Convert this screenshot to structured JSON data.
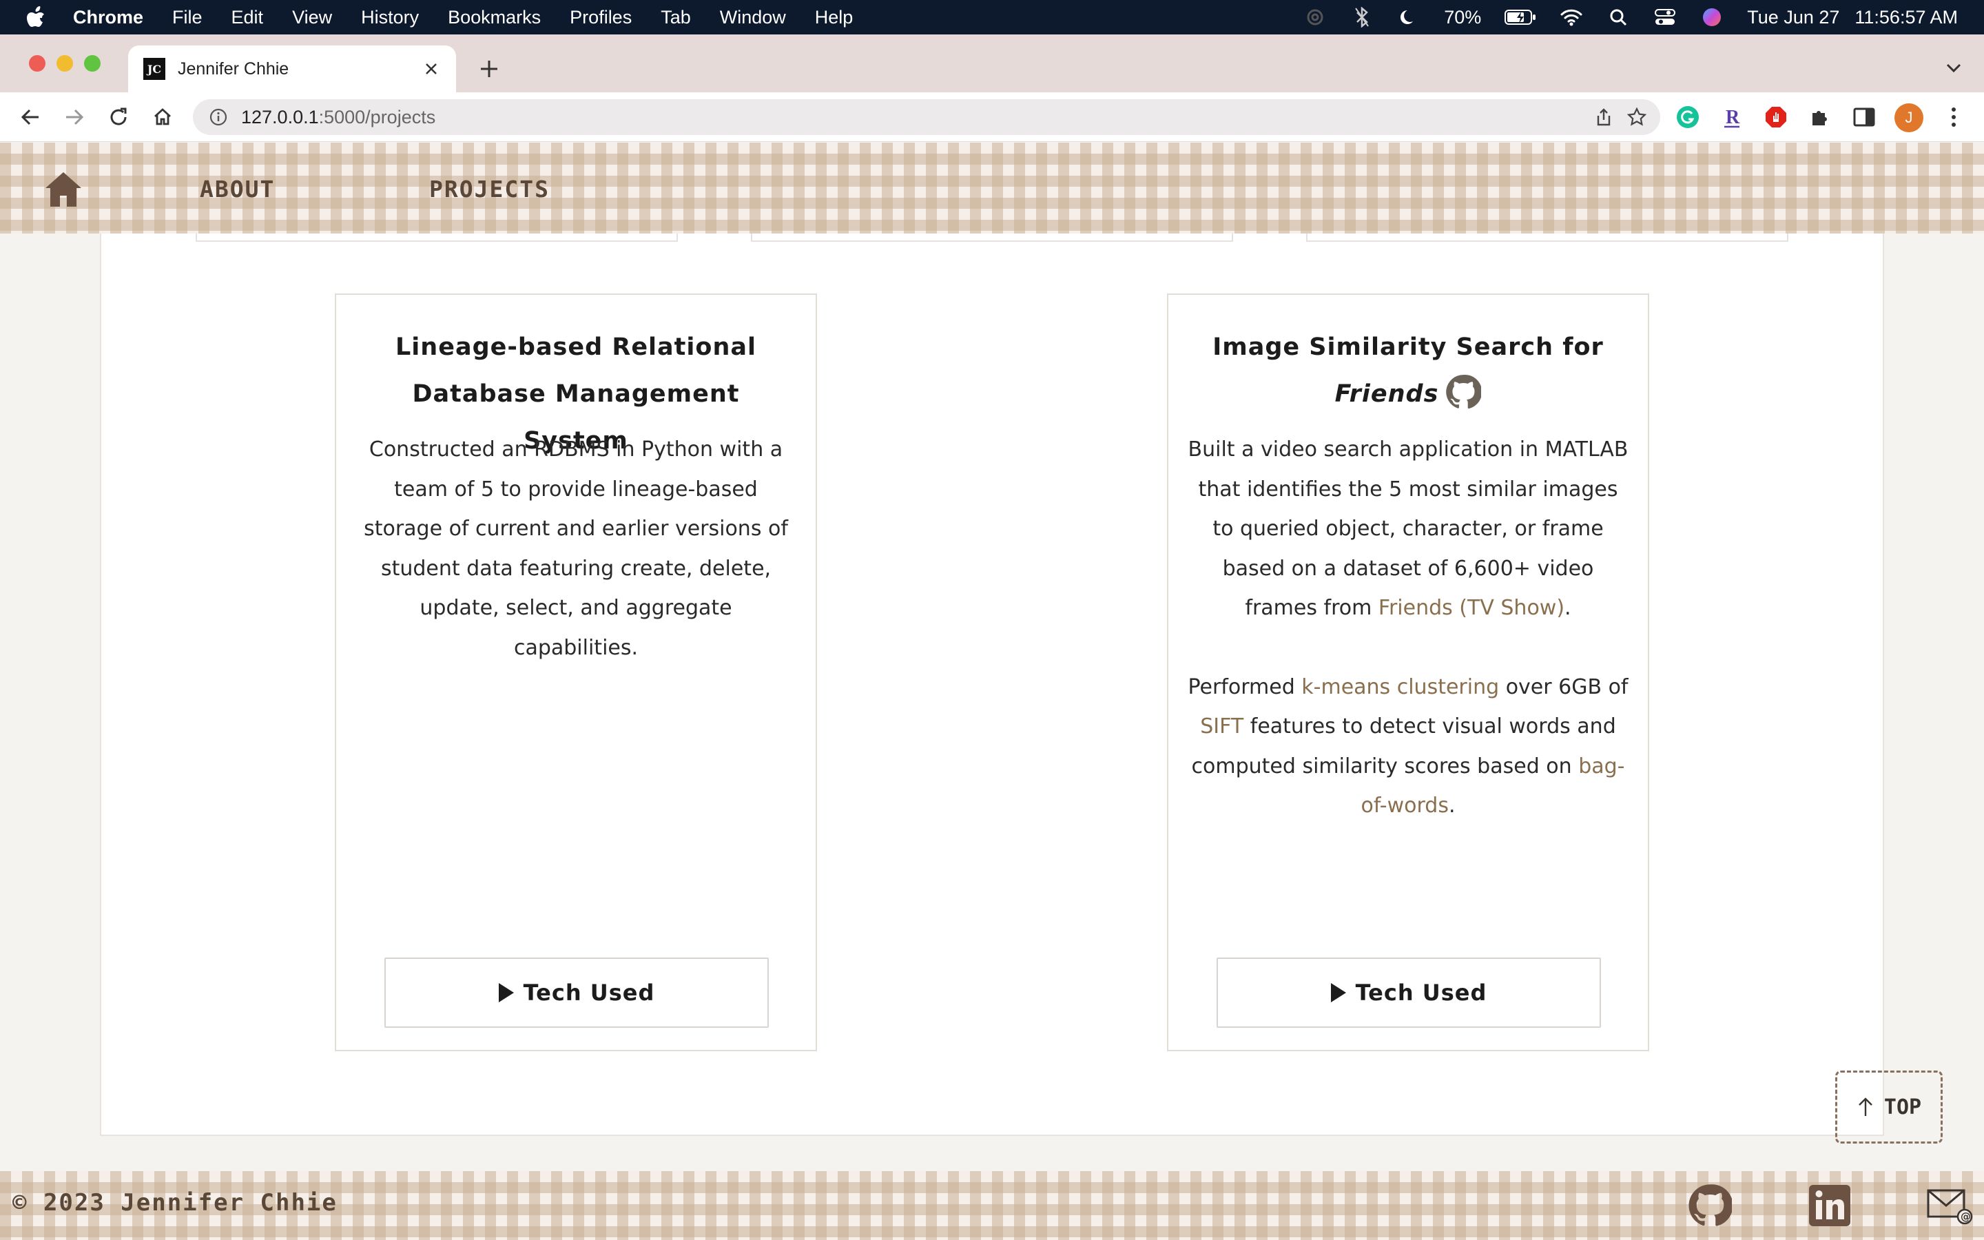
{
  "menubar": {
    "app": "Chrome",
    "items": [
      "File",
      "Edit",
      "View",
      "History",
      "Bookmarks",
      "Profiles",
      "Tab",
      "Window",
      "Help"
    ],
    "battery": "70%",
    "date": "Tue Jun 27",
    "time": "11:56:57 AM"
  },
  "browser": {
    "tab_title": "Jennifer Chhie",
    "favicon_text": "JC",
    "url_host": "127.0.0.1",
    "url_path": ":5000/projects",
    "profile_initial": "J"
  },
  "nav": {
    "about": "ABOUT",
    "projects": "PROJECTS"
  },
  "cards": [
    {
      "title_line1": "Lineage-based Relational",
      "title_line2": "Database Management System",
      "description": "Constructed an RDBMS in Python with a team of 5 to provide lineage-based storage of current and earlier versions of student data featuring create, delete, update, select, and aggregate capabilities.",
      "button": "Tech Used"
    },
    {
      "title_line1": "Image Similarity Search for",
      "title_line2": "Friends",
      "desc_p1_a": "Built a video search application in MATLAB that identifies the 5 most similar images to queried object, character, or frame based on a dataset of 6,600+ video frames from ",
      "desc_p1_link": "Friends (TV Show)",
      "desc_p1_b": ".",
      "desc_p2_a": "Performed ",
      "desc_p2_link1": "k-means clustering",
      "desc_p2_b": " over 6GB of ",
      "desc_p2_link2": "SIFT",
      "desc_p2_c": " features to detect visual words and computed similarity scores based on ",
      "desc_p2_link3": "bag-of-words",
      "desc_p2_d": ".",
      "button": "Tech Used"
    }
  ],
  "top_button": "TOP",
  "footer": {
    "copyright": "© 2023 Jennifer Chhie"
  },
  "colors": {
    "nav_text": "#5b4737",
    "link": "#8a6f4e",
    "gingham": "#c8b096"
  }
}
